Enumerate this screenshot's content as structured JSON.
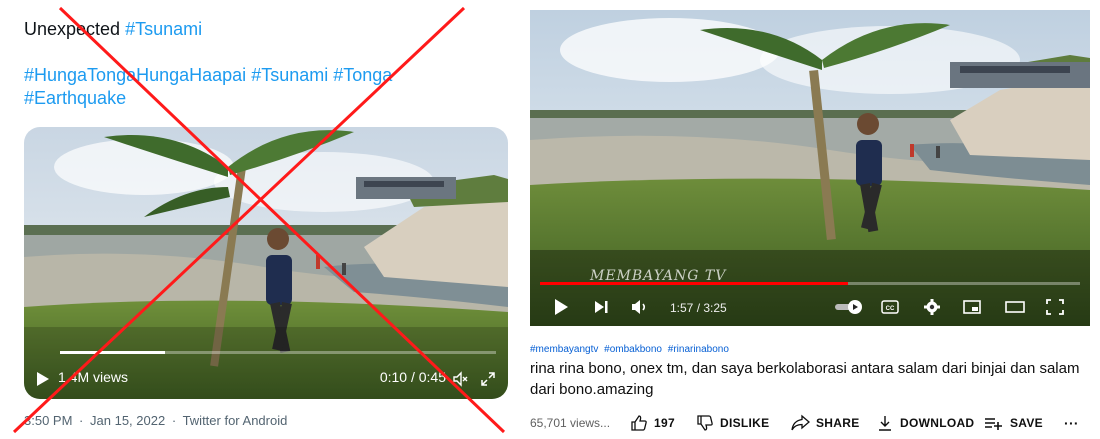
{
  "tweet": {
    "text_word": "Unexpected",
    "text_tag": "#Tsunami",
    "hashtags_line1": [
      "#HungaTongaHungaHaapai",
      "#Tsunami",
      "#Tonga"
    ],
    "hashtags_line2": [
      "#Earthquake"
    ],
    "video": {
      "views": "1.4M views",
      "time": "0:10 / 0:45",
      "progress": 0.24
    },
    "meta": {
      "time": "3:50 PM",
      "date": "Jan 15, 2022",
      "source": "Twitter for Android",
      "separator": "·"
    }
  },
  "youtube": {
    "watermark": "MEMBAYANG TV",
    "time": "1:57 / 3:25",
    "progress": 0.57,
    "tags": [
      "#membayangtv",
      "#ombakbono",
      "#rinarinabono"
    ],
    "title": "rina rina bono, onex tm, dan saya berkolaborasi antara salam dari binjai dan salam dari bono.amazing",
    "views": "65,701 views...",
    "likes": "197",
    "dislike_label": "DISLIKE",
    "share_label": "SHARE",
    "download_label": "DOWNLOAD",
    "save_label": "SAVE",
    "more": "···"
  },
  "colors": {
    "hashtag": "#1d9bf0",
    "cross": "#ff1a1a",
    "yt_progress": "#ff0000",
    "yt_tag": "#065fd4"
  }
}
